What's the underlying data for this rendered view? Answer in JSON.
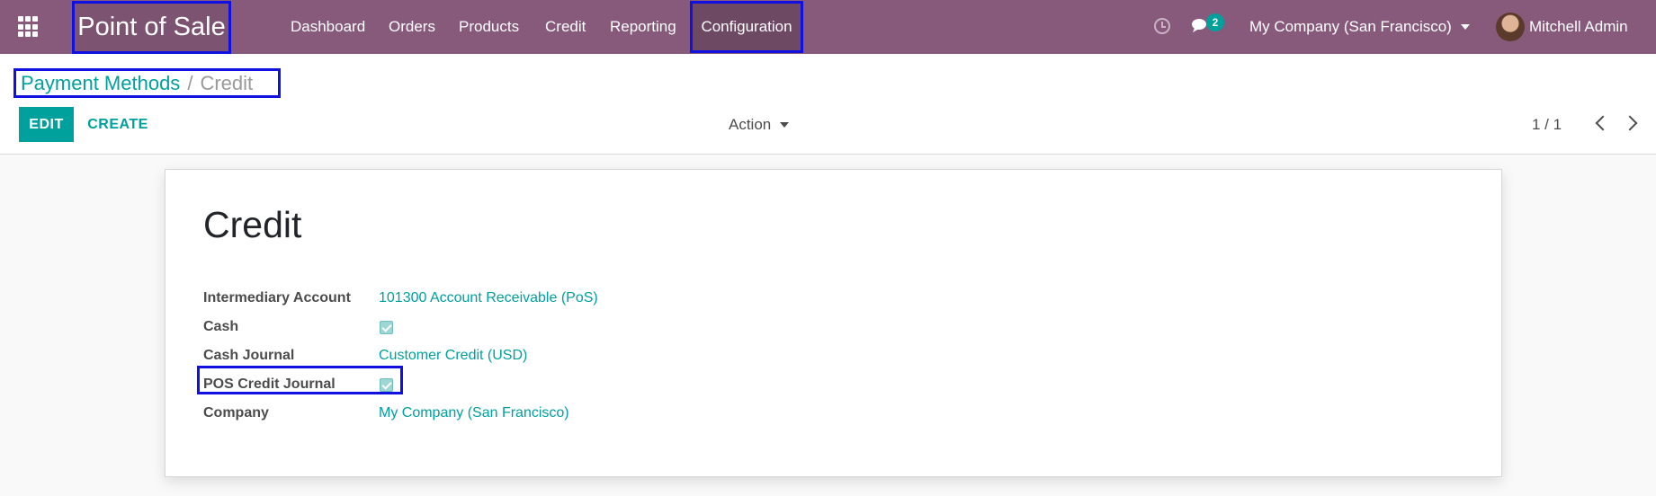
{
  "navbar": {
    "brand": "Point of Sale",
    "menu": [
      "Dashboard",
      "Orders",
      "Products",
      "Credit",
      "Reporting"
    ],
    "active_menu": "Configuration",
    "chat_count": "2",
    "company": "My Company (San Francisco)",
    "user": "Mitchell Admin"
  },
  "control": {
    "breadcrumb_parent": "Payment Methods",
    "breadcrumb_separator": "/",
    "breadcrumb_current": "Credit",
    "edit_label": "EDIT",
    "create_label": "CREATE",
    "action_label": "Action",
    "pager": "1 / 1"
  },
  "form": {
    "title": "Credit",
    "fields": [
      {
        "label": "Intermediary Account",
        "value": "101300 Account Receivable (PoS)"
      },
      {
        "label": "Cash",
        "checked": true
      },
      {
        "label": "Cash Journal",
        "value": "Customer Credit (USD)"
      },
      {
        "label": "POS Credit Journal",
        "checked": true
      },
      {
        "label": "Company",
        "value": "My Company (San Francisco)"
      }
    ]
  },
  "colors": {
    "navbar": "#875a7b",
    "accent": "#00a09d",
    "highlight_box": "#1010e0"
  },
  "icons": [
    "apps-grid-icon",
    "clock-icon",
    "chat-icon",
    "caret-down-icon",
    "chevron-left-icon",
    "chevron-right-icon"
  ]
}
